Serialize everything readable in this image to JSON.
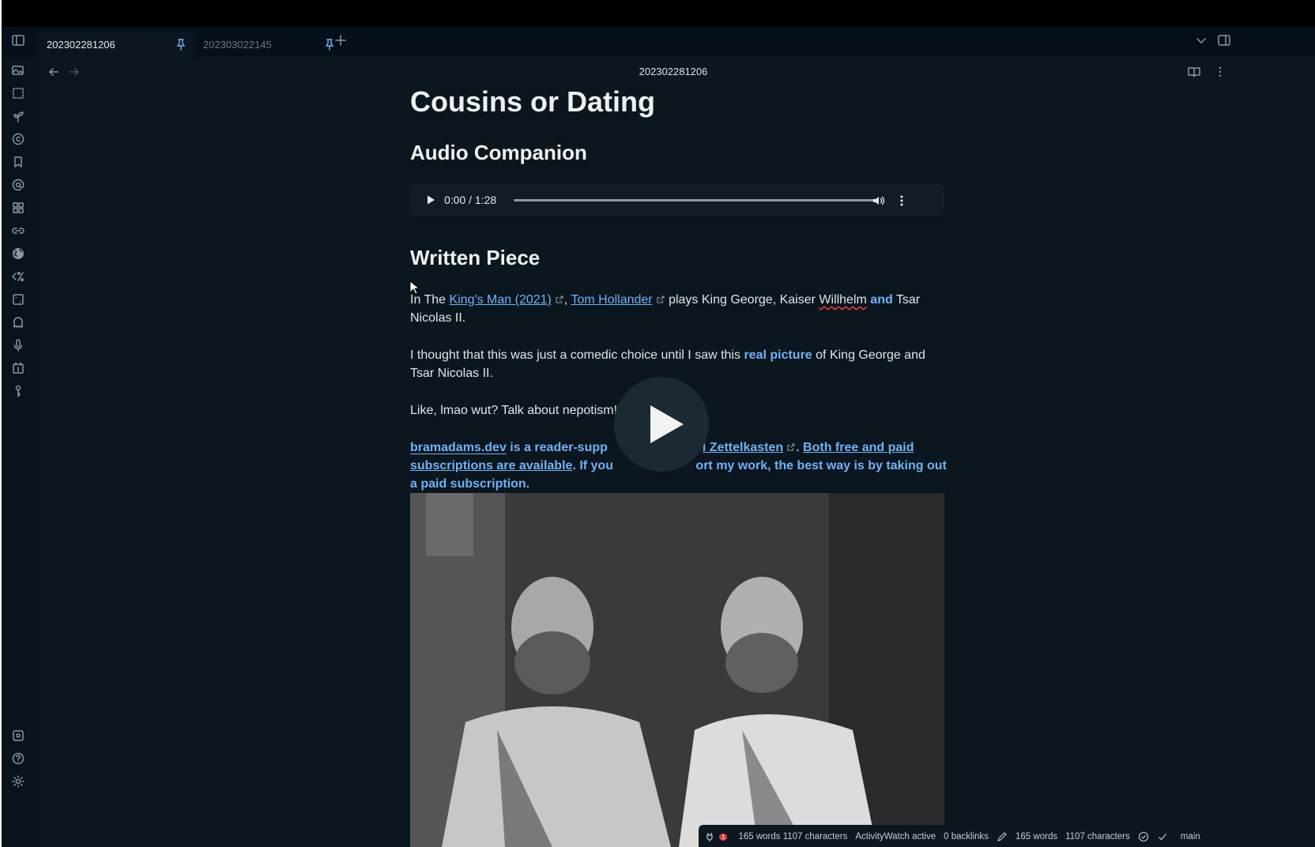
{
  "tabs": [
    {
      "label": "202302281206",
      "active": true
    },
    {
      "label": "202303022145",
      "active": false
    }
  ],
  "header": {
    "title": "202302281206"
  },
  "note": {
    "title": "Cousins or Dating",
    "audio_heading": "Audio Companion",
    "audio": {
      "time": "0:00 / 1:28",
      "progress": 0
    },
    "written_heading": "Written Piece",
    "p1": {
      "a": "In The ",
      "link1": "King's Man (2021)",
      "b": ", ",
      "link2": "Tom Hollander",
      "c": " plays King George, Kaiser ",
      "willhelm": "Willhelm",
      "and": " and",
      "d": " Tsar Nicolas II."
    },
    "p2": {
      "a": "I thought that this was just a comedic choice until I saw this ",
      "bold": "real picture",
      "b": " of King George and Tsar Nicolas II."
    },
    "p3": "Like, lmao wut? Talk about nepotism!",
    "p4": {
      "link1": "bramadams.dev",
      "t1": " is a reader-supp",
      "link2": "l Zettelkasten",
      "t2": ". ",
      "link3": "Both free and paid subscriptions are available",
      "t3": ". If you ",
      "t4": "ort my work, the best way is by taking out a paid subscription."
    }
  },
  "statusbar": {
    "badge": "1",
    "words_chars": "165 words 1107 characters",
    "activitywatch": "ActivityWatch active",
    "backlinks": "0 backlinks",
    "words": "165 words",
    "chars": "1107 characters",
    "branch": "main"
  },
  "colors": {
    "accent": "#6fb3f5",
    "bg": "#0b161e",
    "error": "#e03b3b"
  }
}
